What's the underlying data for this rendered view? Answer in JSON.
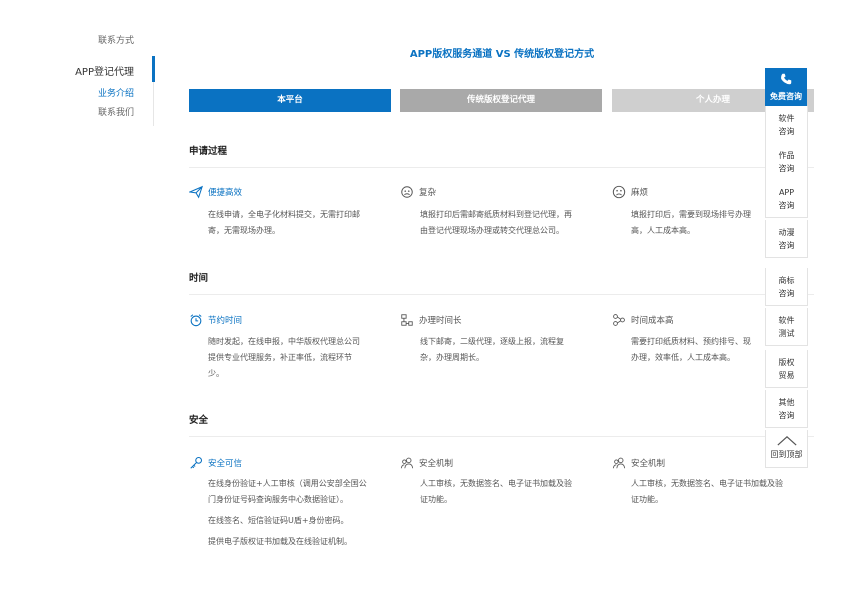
{
  "nav": {
    "contact_top": "联系方式",
    "main": "APP登记代理",
    "sub_intro": "业务介绍",
    "sub_contact": "联系我们"
  },
  "title": "APP版权服务通道 VS 传统版权登记方式",
  "tabs": [
    "本平台",
    "传统版权登记代理",
    "个人办理"
  ],
  "sections": [
    {
      "title": "申请过程",
      "items": [
        {
          "head": "便捷高效",
          "icon": "paper-plane-icon",
          "desc": [
            "在线申请，全电子化材料提交，无需打印邮",
            "寄，无需现场办理。"
          ]
        },
        {
          "head": "复杂",
          "icon": "confused-face-icon",
          "desc": [
            "填报打印后需邮寄纸质材料到登记代理，再",
            "由登记代理现场办理或转交代理总公司。"
          ]
        },
        {
          "head": "麻烦",
          "icon": "sad-face-icon",
          "desc": [
            "填报打印后，需要到现场排号办理",
            "高，人工成本高。"
          ]
        }
      ]
    },
    {
      "title": "时间",
      "items": [
        {
          "head": "节约时间",
          "icon": "alarm-clock-icon",
          "desc": [
            "随时发起，在线申报，中华版权代理总公司",
            "提供专业代理服务，补正率低，流程环节",
            "少。"
          ]
        },
        {
          "head": "办理时间长",
          "icon": "flow-chart-icon",
          "desc": [
            "线下邮寄，二级代理，逐级上报，流程复",
            "杂，办理周期长。"
          ]
        },
        {
          "head": "时间成本高",
          "icon": "process-icon",
          "desc": [
            "需要打印纸质材料、预约排号、现",
            "办理，效率低，人工成本高。"
          ]
        }
      ]
    },
    {
      "title": "安全",
      "items": [
        {
          "head": "安全可信",
          "icon": "key-icon",
          "desc": [
            "在线身份验证+人工审核（调用公安部全国公",
            "门身份证号码查询服务中心数据验证）。",
            "在线签名、短信验证码U盾+身份密码。",
            "提供电子版权证书加载及在线验证机制。"
          ]
        },
        {
          "head": "安全机制",
          "icon": "users-icon",
          "desc": [
            "人工审核，无数据签名、电子证书加载及验",
            "证功能。"
          ]
        },
        {
          "head": "安全机制",
          "icon": "users-icon",
          "desc": [
            "人工审核，无数据签名、电子证书加载及验",
            "证功能。"
          ]
        }
      ]
    }
  ],
  "float_panel": {
    "top": "免费咨询",
    "items": [
      [
        "软件",
        "咨询"
      ],
      [
        "作品",
        "咨询"
      ],
      [
        "APP",
        "咨询"
      ],
      [
        "动漫",
        "咨询"
      ],
      [
        "商标",
        "咨询"
      ],
      [
        "软件",
        "测试"
      ],
      [
        "版权",
        "贸易"
      ],
      [
        "其他",
        "咨询"
      ]
    ],
    "back_top": "回到顶部"
  },
  "colors": {
    "accent": "#0a72c2",
    "tab2": "#a9a9a9",
    "tab3": "#cfcfcf"
  }
}
